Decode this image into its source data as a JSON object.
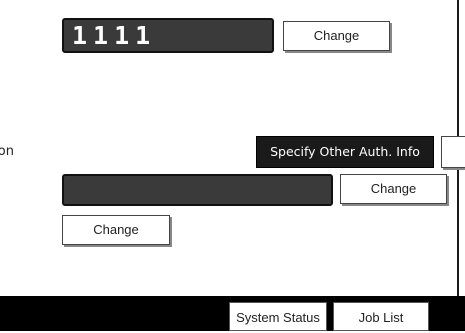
{
  "user_code": {
    "value": "1111",
    "change_label": "Change"
  },
  "side_label_fragment": "on",
  "auth": {
    "specify_other_label": "Specify Other Auth. Info"
  },
  "second_field": {
    "value": "",
    "change_label": "Change"
  },
  "third": {
    "change_label": "Change"
  },
  "status_bar": {
    "system_status_label": "System Status",
    "job_list_label": "Job List"
  },
  "colors": {
    "field_background": "#3a3a3a",
    "status_bar": "#000000",
    "dark_button": "#1a1a1a"
  }
}
